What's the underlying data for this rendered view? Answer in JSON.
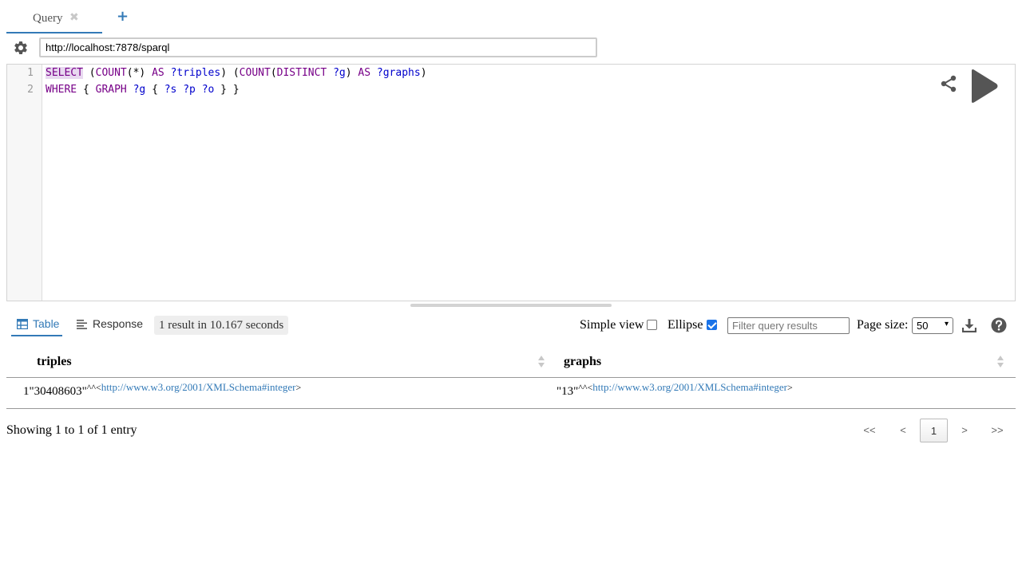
{
  "tabs": {
    "query_label": "Query",
    "close_glyph": "✖",
    "add_glyph": "+"
  },
  "endpoint": {
    "value": "http://localhost:7878/sparql"
  },
  "editor": {
    "line_numbers": [
      "1",
      "2"
    ],
    "lines": [
      [
        {
          "text": "SELECT",
          "cls": "kw hl"
        },
        {
          "text": " (",
          "cls": ""
        },
        {
          "text": "COUNT",
          "cls": "kw"
        },
        {
          "text": "(*) ",
          "cls": ""
        },
        {
          "text": "AS",
          "cls": "kw"
        },
        {
          "text": " ",
          "cls": ""
        },
        {
          "text": "?triples",
          "cls": "var"
        },
        {
          "text": ") (",
          "cls": ""
        },
        {
          "text": "COUNT",
          "cls": "kw"
        },
        {
          "text": "(",
          "cls": ""
        },
        {
          "text": "DISTINCT",
          "cls": "kw"
        },
        {
          "text": " ",
          "cls": ""
        },
        {
          "text": "?g",
          "cls": "var"
        },
        {
          "text": ") ",
          "cls": ""
        },
        {
          "text": "AS",
          "cls": "kw"
        },
        {
          "text": " ",
          "cls": ""
        },
        {
          "text": "?graphs",
          "cls": "var"
        },
        {
          "text": ")",
          "cls": ""
        }
      ],
      [
        {
          "text": "WHERE",
          "cls": "kw"
        },
        {
          "text": " { ",
          "cls": ""
        },
        {
          "text": "GRAPH",
          "cls": "kw"
        },
        {
          "text": " ",
          "cls": ""
        },
        {
          "text": "?g",
          "cls": "var"
        },
        {
          "text": " { ",
          "cls": ""
        },
        {
          "text": "?s",
          "cls": "var"
        },
        {
          "text": " ",
          "cls": ""
        },
        {
          "text": "?p",
          "cls": "var"
        },
        {
          "text": " ",
          "cls": ""
        },
        {
          "text": "?o",
          "cls": "var"
        },
        {
          "text": " } }",
          "cls": ""
        }
      ]
    ]
  },
  "results": {
    "tab_table": "Table",
    "tab_response": "Response",
    "info": "1 result in 10.167 seconds",
    "simple_view_label": "Simple view",
    "simple_view_checked": false,
    "ellipse_label": "Ellipse",
    "ellipse_checked": true,
    "filter_placeholder": "Filter query results",
    "page_size_label": "Page size:",
    "page_size_value": "50",
    "columns": [
      "triples",
      "graphs"
    ],
    "rows": [
      {
        "row_index": "1",
        "triples": {
          "literal": "\"30408603\"",
          "sep": "^^<",
          "datatype": "http://www.w3.org/2001/XMLSchema#integer",
          "close": ">"
        },
        "graphs": {
          "literal": "\"13\"",
          "sep": "^^<",
          "datatype": "http://www.w3.org/2001/XMLSchema#integer",
          "close": ">"
        }
      }
    ],
    "showing": "Showing 1 to 1 of 1 entry",
    "pagination": {
      "first": "<<",
      "prev": "<",
      "current": "1",
      "next": ">",
      "last": ">>"
    }
  },
  "colors": {
    "accent": "#337ab7",
    "keyword": "#770088",
    "variable": "#0000cc",
    "checkbox_checked": "#1a73e8"
  },
  "icons": {
    "settings": "gear-icon",
    "share": "share-icon",
    "run": "play-icon",
    "table": "table-icon",
    "response": "response-icon",
    "download": "download-icon",
    "help": "help-icon"
  }
}
